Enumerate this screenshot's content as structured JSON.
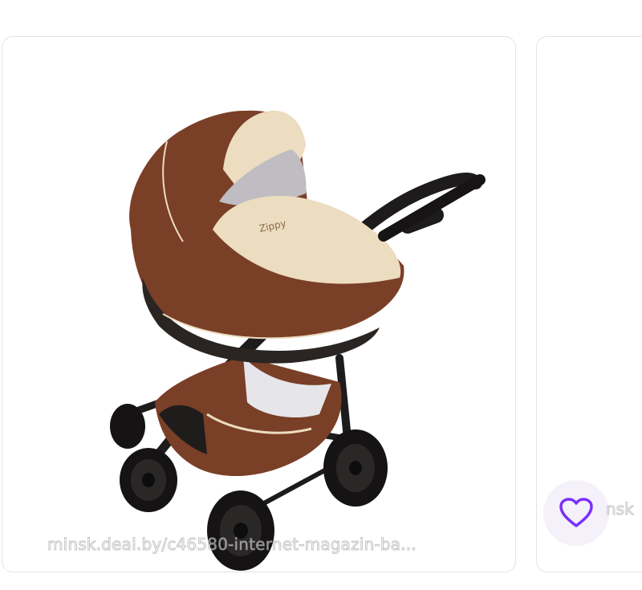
{
  "products": [
    {
      "image_alt": "Коляска Zippy",
      "image_brand_text": "Zippy",
      "watermark": "minsk.deal.by/c46580-internet-magazin-ba..."
    },
    {
      "watermark": "nsk",
      "favorite_icon": "heart-outline-icon",
      "favorite_color": "#7b2ff7"
    }
  ],
  "colors": {
    "card_border": "#e3e3e8",
    "fav_bg": "#f4f1fb",
    "stroller_brown": "#7a3f27",
    "stroller_beige": "#ecdcc0"
  }
}
